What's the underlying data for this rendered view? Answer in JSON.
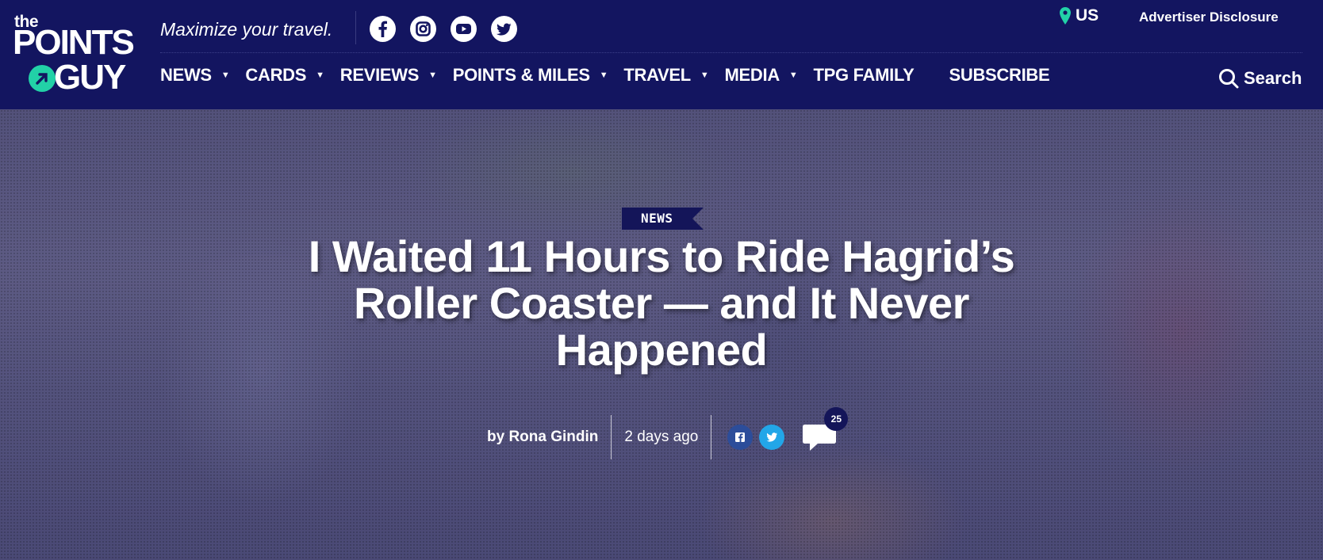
{
  "logo": {
    "line1": "the",
    "line2": "POINTS",
    "line3": "GUY",
    "accent_color": "#22d1a7"
  },
  "header": {
    "tagline": "Maximize your travel.",
    "social_icons": [
      "facebook-icon",
      "instagram-icon",
      "youtube-icon",
      "twitter-icon"
    ],
    "region_label": "US",
    "disclosure_label": "Advertiser Disclosure",
    "search_label": "Search",
    "background_color": "#131560"
  },
  "nav": {
    "items": [
      {
        "label": "NEWS",
        "has_dropdown": true
      },
      {
        "label": "CARDS",
        "has_dropdown": true
      },
      {
        "label": "REVIEWS",
        "has_dropdown": true
      },
      {
        "label": "POINTS & MILES",
        "has_dropdown": true
      },
      {
        "label": "TRAVEL",
        "has_dropdown": true
      },
      {
        "label": "MEDIA",
        "has_dropdown": true
      },
      {
        "label": "TPG FAMILY",
        "has_dropdown": false
      },
      {
        "label": "SUBSCRIBE",
        "has_dropdown": false
      }
    ]
  },
  "article": {
    "category": "NEWS",
    "headline": "I Waited 11 Hours to Ride Hagrid’s Roller Coaster — and It Never Happened",
    "byline": "by Rona Gindin",
    "date": "2 days ago",
    "share_icons": [
      "facebook-share-icon",
      "twitter-share-icon"
    ],
    "comment_count": "25"
  }
}
